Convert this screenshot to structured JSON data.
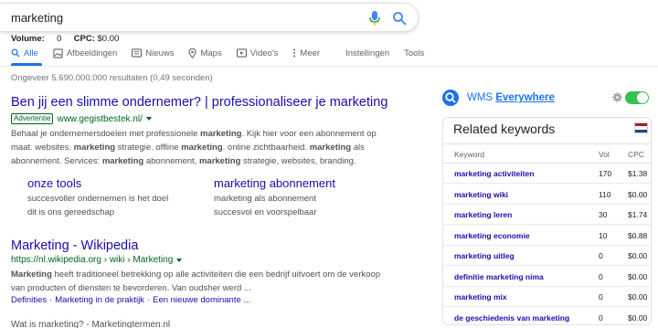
{
  "search": {
    "query": "marketing"
  },
  "keyword_meta": {
    "volume_label": "Volume:",
    "volume_value": "0",
    "cpc_label": "CPC:",
    "cpc_value": "$0.00"
  },
  "tabs": [
    {
      "label": "Alle",
      "icon": "search-icon",
      "active": true
    },
    {
      "label": "Afbeeldingen",
      "icon": "image-icon",
      "active": false
    },
    {
      "label": "Nieuws",
      "icon": "news-icon",
      "active": false
    },
    {
      "label": "Maps",
      "icon": "map-pin-icon",
      "active": false
    },
    {
      "label": "Video's",
      "icon": "video-icon",
      "active": false
    },
    {
      "label": "Meer",
      "icon": "more-vert-icon",
      "active": false
    },
    {
      "label": "Instellingen",
      "icon": "",
      "active": false
    },
    {
      "label": "Tools",
      "icon": "",
      "active": false
    }
  ],
  "result_stats": "Ongeveer 5.690.000.000 resultaten (0,49 seconden)",
  "ad_result": {
    "title": "Ben jij een slimme ondernemer? | professionaliseer je marketing",
    "badge": "Advertentie",
    "url": "www.gegistbestek.nl/",
    "snippet_parts": [
      {
        "t": "Behaal je ondernemersdoelen met professionele ",
        "b": false
      },
      {
        "t": "marketing",
        "b": true
      },
      {
        "t": ". Kijk hier voor een abonnement op maat. websites. ",
        "b": false
      },
      {
        "t": "marketing",
        "b": true
      },
      {
        "t": " strategie. offline ",
        "b": false
      },
      {
        "t": "marketing",
        "b": true
      },
      {
        "t": ". online zichtbaarheid. ",
        "b": false
      },
      {
        "t": "marketing",
        "b": true
      },
      {
        "t": " als abonnement. Services: ",
        "b": false
      },
      {
        "t": "marketing",
        "b": true
      },
      {
        "t": " abonnement, ",
        "b": false
      },
      {
        "t": "marketing",
        "b": true
      },
      {
        "t": " strategie, websites, branding.",
        "b": false
      }
    ],
    "sitelinks": [
      {
        "title": "onze tools",
        "desc1": "succesvoller ondernemen is het doel",
        "desc2": "dit is ons gereedschap"
      },
      {
        "title": "marketing abonnement",
        "desc1": "marketing als abonnement",
        "desc2": "succesvol en voorspelbaar"
      }
    ]
  },
  "organic_result": {
    "title": "Marketing - Wikipedia",
    "url": "https://nl.wikipedia.org › wiki › Marketing",
    "snippet_parts": [
      {
        "t": "Marketing",
        "b": true
      },
      {
        "t": " heeft traditioneel betrekking op alle activiteiten die een bedrijf uitvoert om de verkoop van producten of diensten te bevorderen. Van oudsher werd ...",
        "b": false
      }
    ],
    "links": [
      "Definities",
      "Marketing in de praktijk",
      "Een nieuwe dominante ..."
    ]
  },
  "cut_off_text": "Wat is marketing? - Marketingtermen.nl",
  "wms": {
    "brand": "WMS",
    "everywhere": "Everywhere",
    "toggle_on": true,
    "card_title": "Related keywords",
    "columns": {
      "keyword": "Keyword",
      "vol": "Vol",
      "cpc": "CPC"
    },
    "rows": [
      {
        "keyword": "marketing activiteiten",
        "vol": "170",
        "cpc": "$1.38"
      },
      {
        "keyword": "marketing wiki",
        "vol": "110",
        "cpc": "$0.00"
      },
      {
        "keyword": "marketing leren",
        "vol": "30",
        "cpc": "$1.74"
      },
      {
        "keyword": "marketing economie",
        "vol": "10",
        "cpc": "$0.88"
      },
      {
        "keyword": "marketing uitleg",
        "vol": "0",
        "cpc": "$0.00"
      },
      {
        "keyword": "definitie marketing nima",
        "vol": "0",
        "cpc": "$0.00"
      },
      {
        "keyword": "marketing mix",
        "vol": "0",
        "cpc": "$0.00"
      },
      {
        "keyword": "de geschiedenis van marketing",
        "vol": "0",
        "cpc": "$0.00"
      }
    ],
    "colors": {
      "accent": "#1a73e8",
      "toggle": "#34c252"
    }
  }
}
